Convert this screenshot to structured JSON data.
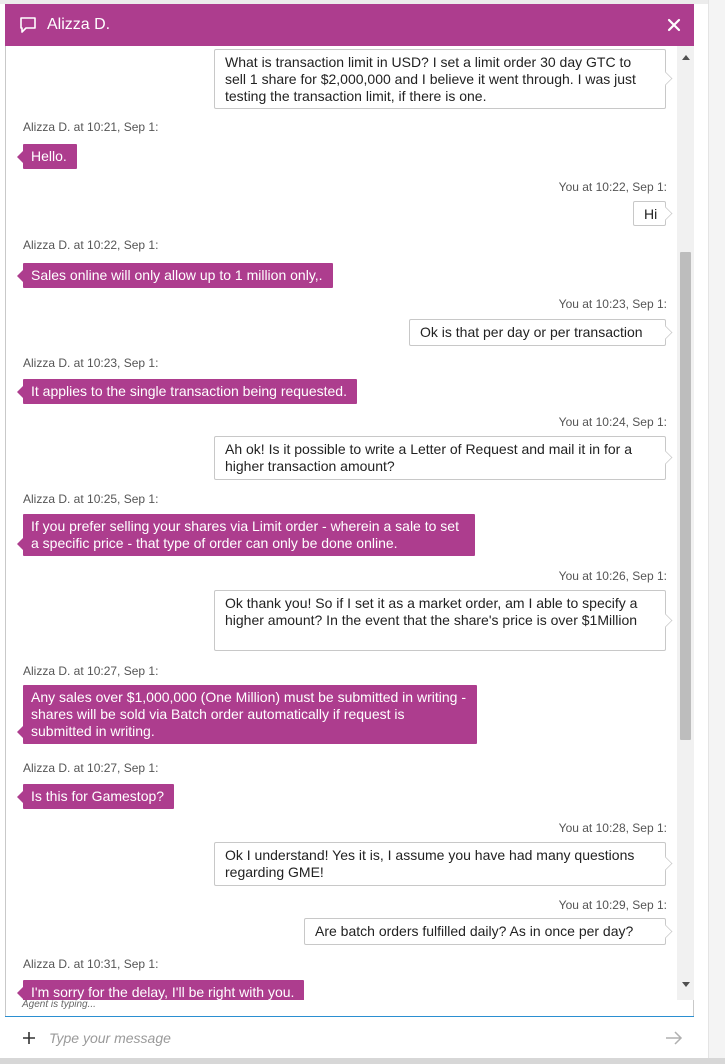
{
  "header": {
    "title": "Alizza D.",
    "chat_icon": "chat-bubble-icon",
    "close_icon": "close-icon",
    "color": "#ad3d8e"
  },
  "messages": [
    {
      "sender": "user",
      "meta": "",
      "text": "What is transaction limit in USD? I set a limit order 30 day GTC to sell 1 share for $2,000,000 and I believe it went through. I was just testing the transaction limit, if there is one."
    },
    {
      "sender": "agent",
      "meta": "Alizza D. at 10:21, Sep 1:",
      "text": "Hello."
    },
    {
      "sender": "user",
      "meta": "You at 10:22, Sep 1:",
      "text": "Hi"
    },
    {
      "sender": "agent",
      "meta": "Alizza D. at 10:22, Sep 1:",
      "text": "Sales online will only allow up to 1 million only,."
    },
    {
      "sender": "user",
      "meta": "You at 10:23, Sep 1:",
      "text": "Ok is that per day or per transaction"
    },
    {
      "sender": "agent",
      "meta": "Alizza D. at 10:23, Sep 1:",
      "text": "It applies to the single transaction being requested."
    },
    {
      "sender": "user",
      "meta": "You at 10:24, Sep 1:",
      "text": "Ah ok! Is it possible to write a Letter of Request and mail it in for a higher transaction amount?"
    },
    {
      "sender": "agent",
      "meta": "Alizza D. at 10:25, Sep 1:",
      "text": "If you prefer selling your shares via Limit order - wherein a sale to set a specific price - that type of order can only be done online."
    },
    {
      "sender": "user",
      "meta": "You at 10:26, Sep 1:",
      "text": "Ok thank you! So if I set it as a market order, am I able to specify a higher amount? In the event that the share's price is over $1Million"
    },
    {
      "sender": "agent",
      "meta": "Alizza D. at 10:27, Sep 1:",
      "text": "Any sales over $1,000,000 (One Million) must be submitted in writing - shares will be sold via Batch order automatically if request is submitted in writing."
    },
    {
      "sender": "agent",
      "meta": "Alizza D. at 10:27, Sep 1:",
      "text": "Is this for Gamestop?"
    },
    {
      "sender": "user",
      "meta": "You at 10:28, Sep 1:",
      "text": "Ok I understand! Yes it is, I assume you have had many questions regarding GME!"
    },
    {
      "sender": "user",
      "meta": "You at 10:29, Sep 1:",
      "text": "Are batch orders fulfilled daily? As in once per day?"
    },
    {
      "sender": "agent",
      "meta": "Alizza D. at 10:31, Sep 1:",
      "text": "I'm sorry for the delay, I'll be right with you."
    }
  ],
  "status": {
    "typing": "Agent is typing..."
  },
  "composer": {
    "placeholder": "Type your message",
    "value": "",
    "attach_icon": "plus-icon",
    "send_icon": "send-arrow-icon"
  },
  "scrollbar": {
    "up_icon": "scroll-up-arrow-icon",
    "down_icon": "scroll-down-arrow-icon"
  }
}
